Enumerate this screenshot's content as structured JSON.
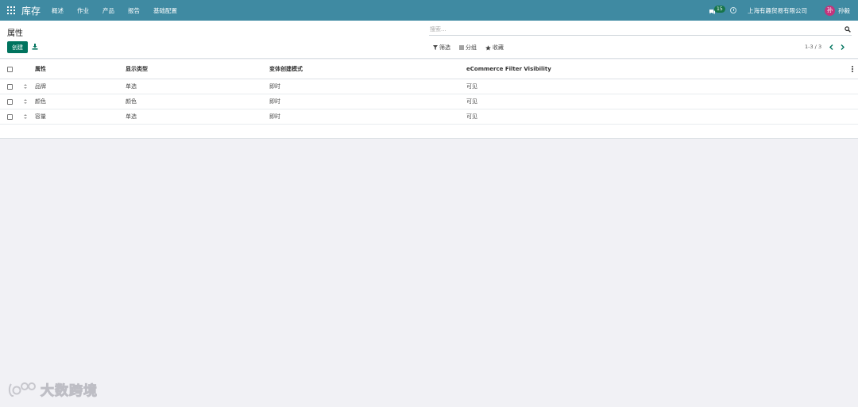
{
  "navbar": {
    "brand": "库存",
    "menu": [
      "概述",
      "作业",
      "产品",
      "报告",
      "基础配置"
    ],
    "message_count": "15",
    "company": "上海有趣贸易有限公司",
    "avatar_initial": "孙",
    "username": "孙毅"
  },
  "control": {
    "title": "属性",
    "create_label": "创建",
    "search_placeholder": "搜索...",
    "filter_label": "筛选",
    "group_label": "分组",
    "favorite_label": "收藏",
    "pager": "1-3 / 3"
  },
  "list": {
    "columns": [
      "属性",
      "显示类型",
      "变体创建模式",
      "eCommerce Filter Visibility"
    ],
    "rows": [
      [
        "品牌",
        "单选",
        "即时",
        "可见"
      ],
      [
        "颜色",
        "颜色",
        "即时",
        "可见"
      ],
      [
        "容量",
        "单选",
        "即时",
        "可见"
      ]
    ]
  },
  "watermark": "大数跨境",
  "colors": {
    "navbar": "#3f8aa2",
    "primary_button": "#00735e",
    "badge": "#17754a",
    "avatar": "#c2347c",
    "background": "#f1f1f5"
  }
}
